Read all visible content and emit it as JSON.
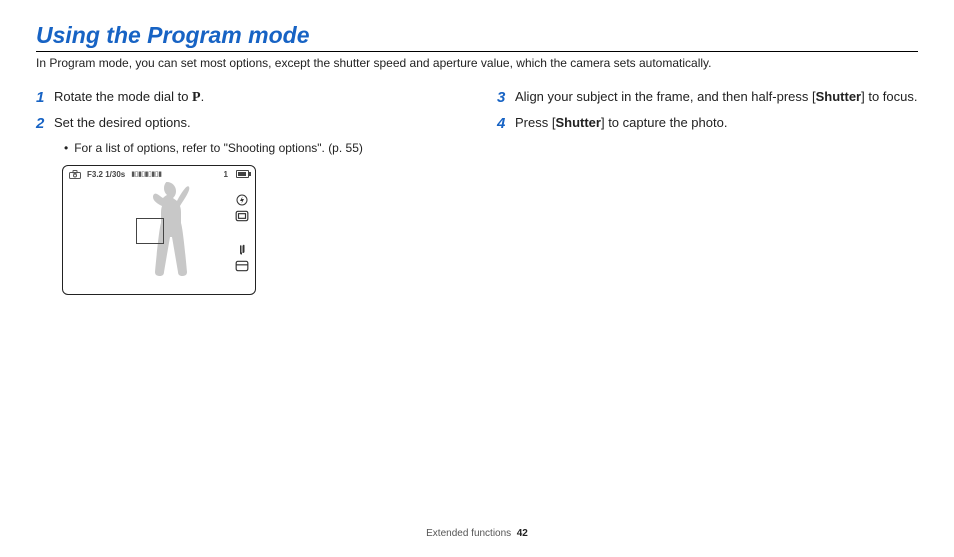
{
  "heading": "Using the Program mode",
  "intro": "In Program mode, you can set most options, except the shutter speed and aperture value, which the camera sets automatically.",
  "steps": {
    "s1": {
      "num": "1",
      "pre": "Rotate the mode dial to ",
      "mode": "P",
      "post": "."
    },
    "s2": {
      "num": "2",
      "text": "Set the desired options.",
      "bullet": "For a list of options, refer to \"Shooting options\". (p. 55)"
    },
    "s3": {
      "num": "3",
      "pre": "Align your subject in the frame, and then half-press [",
      "bold": "Shutter",
      "post": "] to focus."
    },
    "s4": {
      "num": "4",
      "pre": "Press [",
      "bold": "Shutter",
      "post": "] to capture the photo."
    }
  },
  "lcd": {
    "aperture_shutter": "F3.2 1/30s",
    "exposure_scale": "▮▯▮▯▮▯▮▯▮",
    "shots": "1"
  },
  "footer": {
    "section": "Extended functions",
    "page": "42"
  }
}
